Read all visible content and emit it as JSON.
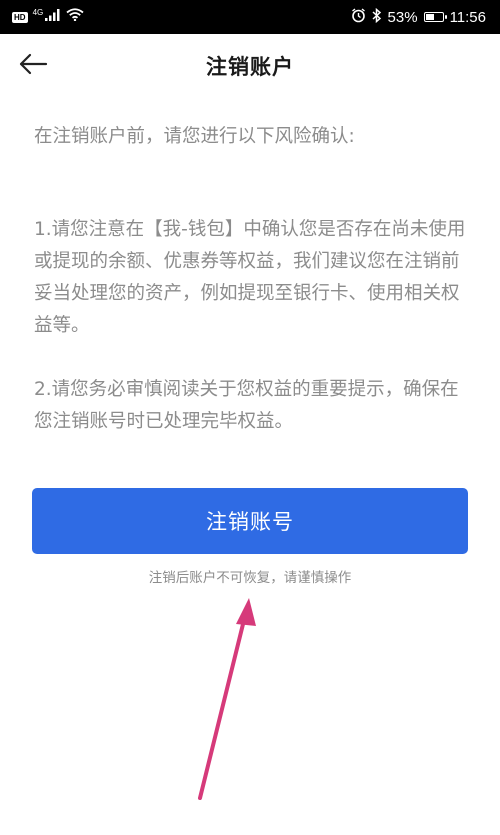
{
  "status_bar": {
    "hd_badge": "HD",
    "network_type": "4G",
    "battery_percent": "53%",
    "battery_level": 0.53,
    "time": "11:56",
    "icons": [
      "signal-icon",
      "wifi-icon",
      "alarm-icon",
      "bluetooth-icon",
      "battery-icon"
    ]
  },
  "nav": {
    "title": "注销账户",
    "back_icon": "arrow-left-icon"
  },
  "content": {
    "intro": "在注销账户前，请您进行以下风险确认:",
    "items": [
      "1.请您注意在【我-钱包】中确认您是否存在尚未使用或提现的余额、优惠券等权益，我们建议您在注销前妥当处理您的资产，例如提现至银行卡、使用相关权益等。",
      "2.请您务必审慎阅读关于您权益的重要提示，确保在您注销账号时已处理完毕权益。"
    ]
  },
  "action": {
    "button_label": "注销账号",
    "warning": "注销后账户不可恢复，请谨慎操作"
  },
  "colors": {
    "primary": "#2f6be4",
    "text_secondary": "#8c8c8c",
    "annotation_arrow": "#d63a7a"
  }
}
